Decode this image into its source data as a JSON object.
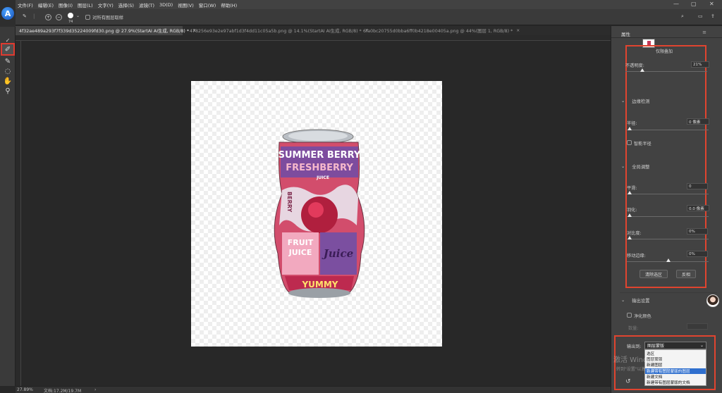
{
  "app": {
    "logo_letter": "A",
    "menu": [
      "文件(F)",
      "编辑(E)",
      "图像(I)",
      "图层(L)",
      "文字(Y)",
      "选择(S)",
      "滤镜(T)",
      "3D(D)",
      "视图(V)",
      "窗口(W)",
      "帮助(H)"
    ],
    "window_controls": {
      "minimize": "—",
      "maximize": "▢",
      "close": "✕"
    }
  },
  "options_bar": {
    "brush_size": "74",
    "sample_all_layers": "对所有图层取样",
    "add_symbol": "+",
    "subtract_symbol": "−"
  },
  "tabs": [
    {
      "label": "4f32ae489a293f7f339d35224009fd30.png @ 27.9%(StartAI AI生成, RGB/8) *",
      "active": true
    },
    {
      "label": "478256e93e2e97abf1d3f4dd11c05a5b.png @ 14.1%(StartAI AI生成, RGB/8) *",
      "active": false
    },
    {
      "label": "6fa0bc20755d0bba6ff0b4218e00405a.png @ 44%(图层 1, RGB/8) *",
      "active": false
    }
  ],
  "tab_close": "×",
  "status": {
    "zoom": "27.89%",
    "doc_size": "文档:17.2M/19.7M",
    "arrow": "›"
  },
  "can_artwork": {
    "line1": "SUMMER BERRY",
    "line2": "FRESHBERRY",
    "badge": "JUICE",
    "side": "BERRY",
    "fruit": "FRUIT",
    "juice": "JUICE",
    "juice_script": "Juice",
    "yummy": "YUMMY"
  },
  "properties": {
    "tab": "属性",
    "view_mode": "仅限叠加",
    "opacity_label": "不透明度:",
    "opacity_value": "21%",
    "opacity_level": 0.21,
    "edge_detection_title": "边缘检测",
    "radius_label": "半径:",
    "radius_value": "0 像素",
    "smart_radius_label": "智能半径",
    "global_refine_title": "全局调整",
    "smooth_label": "平滑:",
    "smooth_value": "0",
    "feather_label": "羽化:",
    "feather_value": "0.0 像素",
    "contrast_label": "对比度:",
    "contrast_value": "0%",
    "shift_edge_label": "移动边缘:",
    "shift_edge_value": "0%",
    "clear_selection_button": "清除选区",
    "invert_button": "反相",
    "output_settings_title": "输出设置",
    "decontaminate_label": "净化颜色",
    "amount_label": "数量:",
    "output_to_label": "输出到:",
    "output_to_value": "图层蒙版",
    "output_options": [
      "选区",
      "图层蒙版",
      "新建图层",
      "新建带有图层蒙版的图层",
      "新建文档",
      "新建带有图层蒙版的文档"
    ],
    "output_selected": "新建带有图层蒙版的图层",
    "collapse_arrow": "⌄"
  },
  "watermark": {
    "line1": "激活 Windows",
    "line2": "转到\"设置\"以激活 Windows。"
  },
  "colors": {
    "highlight": "#e0442f",
    "selection": "#2f6fce"
  }
}
